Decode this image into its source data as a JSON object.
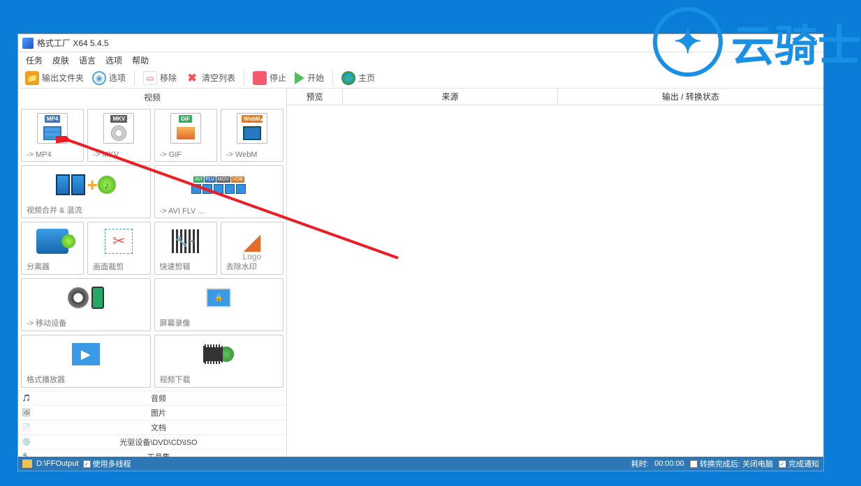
{
  "watermark": {
    "text": "云骑士"
  },
  "window": {
    "title": "格式工厂 X64 5.4.5",
    "close": "×"
  },
  "menu": {
    "task": "任务",
    "skin": "皮肤",
    "lang": "语言",
    "opts": "选项",
    "help": "帮助"
  },
  "toolbar": {
    "output_folder": "输出文件夹",
    "options": "选项",
    "remove": "移除",
    "clear": "清空列表",
    "stop": "停止",
    "start": "开始",
    "home": "主页"
  },
  "sidebar": {
    "header": "视频",
    "tiles": {
      "mp4": "-> MP4",
      "mkv": "-> MKV",
      "gif": "-> GIF",
      "webm": "-> WebM",
      "merge": "视频合并 & 混流",
      "avi_etc": "-> AVI FLV ...",
      "splitter": "分离器",
      "crop": "画面裁剪",
      "quickcut": "快速剪辑",
      "watermark": "去除水印",
      "mobile": "-> 移动设备",
      "screenrec": "屏幕录像",
      "player": "格式播放器",
      "download": "视频下载"
    },
    "tags": {
      "mp4": "MP4",
      "mkv": "MKV",
      "gif": "GIF",
      "webm": "WebM",
      "avi": "AVI",
      "flv": "FLV",
      "mov": "MOV",
      "vob": "VOB",
      "logo": "Logo"
    },
    "categories": {
      "audio": "音频",
      "image": "图片",
      "doc": "文档",
      "optical": "光驱设备\\DVD\\CD\\ISO",
      "tools": "工具集"
    }
  },
  "columns": {
    "preview": "预览",
    "source": "来源",
    "status": "输出 / 转换状态"
  },
  "statusbar": {
    "output_path": "D:\\FFOutput",
    "multithread": "使用多线程",
    "elapsed_label": "耗时:",
    "elapsed_time": "00:00:00",
    "after_done": "转换完成后:",
    "shutdown": "关闭电脑",
    "notify": "完成通知"
  }
}
